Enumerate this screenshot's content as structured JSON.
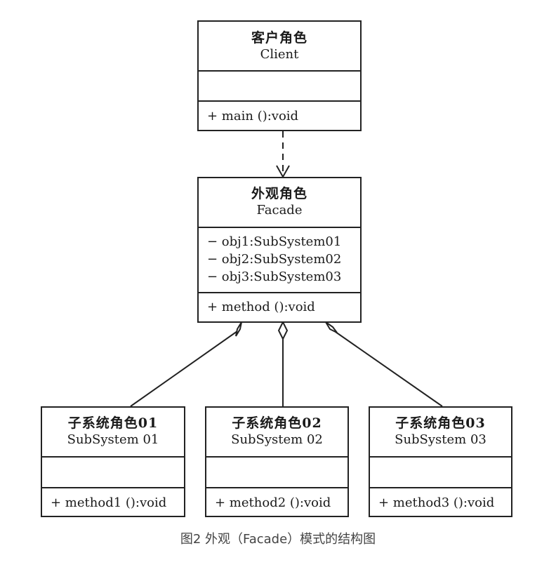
{
  "client": {
    "cn_name": "客户角色",
    "en_name": "Client",
    "attributes": [],
    "methods": [
      "+ main ():void"
    ]
  },
  "facade": {
    "cn_name": "外观角色",
    "en_name": "Facade",
    "attributes": [
      "− obj1:SubSystem01",
      "− obj2:SubSystem02",
      "− obj3:SubSystem03"
    ],
    "methods": [
      "+ method ():void"
    ]
  },
  "subsystems": [
    {
      "cn_name": "子系统角色01",
      "en_name": "SubSystem 01",
      "methods": [
        "+ method1 ():void"
      ]
    },
    {
      "cn_name": "子系统角色02",
      "en_name": "SubSystem 02",
      "methods": [
        "+ method2 ():void"
      ]
    },
    {
      "cn_name": "子系统角色03",
      "en_name": "SubSystem 03",
      "methods": [
        "+ method3 ():void"
      ]
    }
  ],
  "caption": "图2 外观（Facade）模式的结构图",
  "colors": {
    "line": "#222222",
    "caption": "#444444"
  }
}
